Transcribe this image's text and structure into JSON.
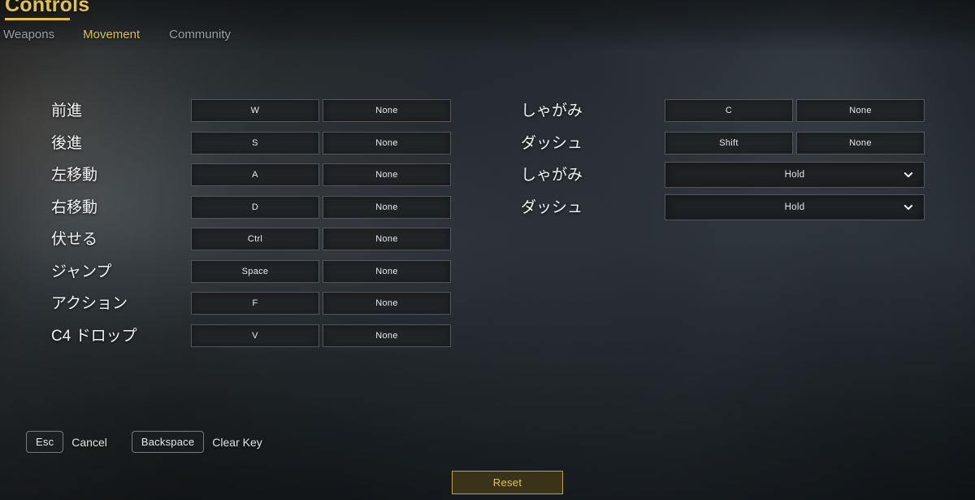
{
  "header": {
    "title": "Controls",
    "tabs": [
      {
        "label": "Weapons",
        "active": false
      },
      {
        "label": "Movement",
        "active": true
      },
      {
        "label": "Community",
        "active": false
      }
    ]
  },
  "bindings": {
    "left_column": [
      {
        "label": "前進",
        "type": "keys",
        "primary": "W",
        "secondary": "None"
      },
      {
        "label": "後進",
        "type": "keys",
        "primary": "S",
        "secondary": "None"
      },
      {
        "label": "左移動",
        "type": "keys",
        "primary": "A",
        "secondary": "None"
      },
      {
        "label": "右移動",
        "type": "keys",
        "primary": "D",
        "secondary": "None"
      },
      {
        "label": "伏せる",
        "type": "keys",
        "primary": "Ctrl",
        "secondary": "None"
      },
      {
        "label": "ジャンプ",
        "type": "keys",
        "primary": "Space",
        "secondary": "None"
      },
      {
        "label": "アクション",
        "type": "keys",
        "primary": "F",
        "secondary": "None"
      },
      {
        "label": "C4 ドロップ",
        "type": "keys",
        "primary": "V",
        "secondary": "None"
      }
    ],
    "right_column": [
      {
        "label": "しゃがみ",
        "type": "keys",
        "primary": "C",
        "secondary": "None"
      },
      {
        "label": "ダッシュ",
        "type": "keys",
        "primary": "Shift",
        "secondary": "None"
      },
      {
        "label": "しゃがみ",
        "type": "dropdown",
        "value": "Hold",
        "icon": "chevron-down-icon"
      },
      {
        "label": "ダッシュ",
        "type": "dropdown",
        "value": "Hold",
        "icon": "chevron-down-icon"
      }
    ]
  },
  "hints": [
    {
      "key": "Esc",
      "action": "Cancel"
    },
    {
      "key": "Backspace",
      "action": "Clear Key"
    }
  ],
  "footer": {
    "reset_label": "Reset"
  },
  "colors": {
    "accent_gold": "#e2c243",
    "tab_active": "#dcc052",
    "tab_inactive": "#9aa0a4",
    "field_fill": "#212427",
    "field_border": "#51565c",
    "reset_fill": "#3b3317",
    "reset_border": "#bda23f",
    "reset_text": "#e3c64c"
  }
}
